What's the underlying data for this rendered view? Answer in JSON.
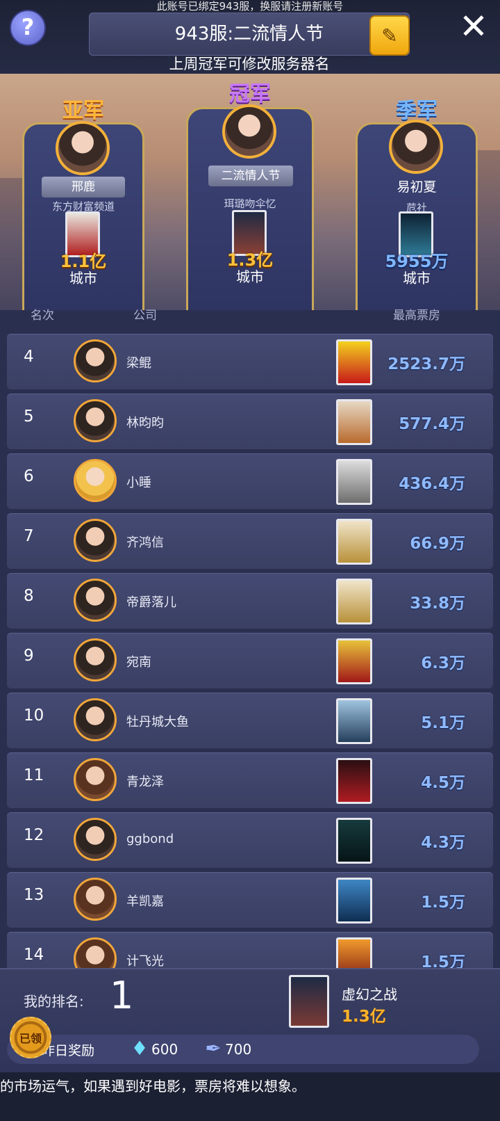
{
  "header": {
    "notice": "此账号已绑定943服，换服请注册新账号",
    "server_name": "943服:二流情人节",
    "server_hint": "上周冠军可修改服务器名",
    "help_icon": "?",
    "close_icon": "✕"
  },
  "podium": {
    "second": {
      "label": "亚军",
      "player": "邢鹿",
      "company": "东方财富频道",
      "box_office": "1.1亿",
      "city": "城市"
    },
    "first": {
      "label": "冠军",
      "player": "二流情人节",
      "company": "珥璐吻伞忆",
      "box_office": "1.3亿",
      "city": "城市"
    },
    "third": {
      "label": "季军",
      "player": "易初夏",
      "company": "苊社",
      "box_office": "5955万",
      "city": "城市"
    }
  },
  "list_header": {
    "rank": "名次",
    "company": "公司",
    "top_box": "最高票房"
  },
  "ranking": [
    {
      "rank": "4",
      "name": "梁鲲",
      "value": "2523.7万"
    },
    {
      "rank": "5",
      "name": "林昀昀",
      "value": "577.4万"
    },
    {
      "rank": "6",
      "name": "小睡",
      "value": "436.4万"
    },
    {
      "rank": "7",
      "name": "齐鸿信",
      "value": "66.9万"
    },
    {
      "rank": "8",
      "name": "帝爵落儿",
      "value": "33.8万"
    },
    {
      "rank": "9",
      "name": "宛南",
      "value": "6.3万"
    },
    {
      "rank": "10",
      "name": "牡丹城大鱼",
      "value": "5.1万"
    },
    {
      "rank": "11",
      "name": "青龙泽",
      "value": "4.5万"
    },
    {
      "rank": "12",
      "name": "ggbond",
      "value": "4.3万"
    },
    {
      "rank": "13",
      "name": "羊凯嘉",
      "value": "1.5万"
    },
    {
      "rank": "14",
      "name": "计飞光",
      "value": "1.5万"
    }
  ],
  "my_rank": {
    "label": "我的排名:",
    "rank": "1",
    "movie": "虚幻之战",
    "value": "1.3亿",
    "claimed": "已领",
    "reward_label": "昨日奖励",
    "gems": "600",
    "quills": "700"
  },
  "ticker": "的市场运气，如果遇到好电影，票房将难以想象。",
  "colors": {
    "accent_gold": "#ffc23a",
    "value_blue": "#8fbaff",
    "row_bg": "#444a73"
  }
}
